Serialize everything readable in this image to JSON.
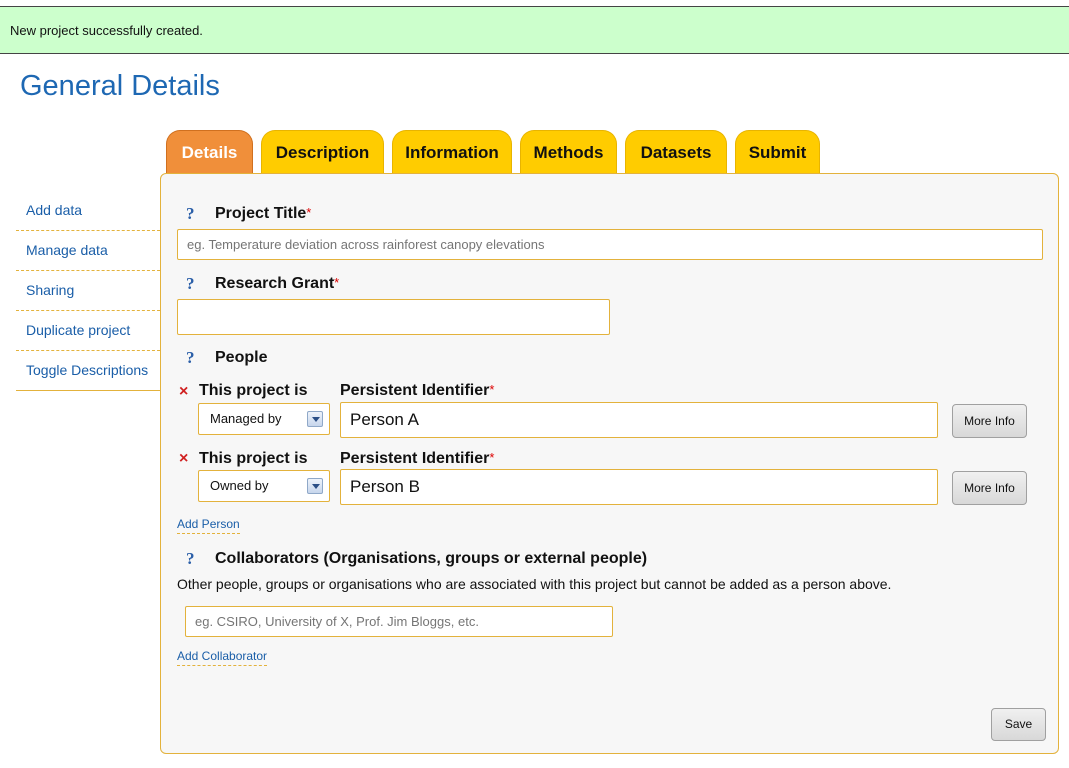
{
  "notice": {
    "message": "New project successfully created."
  },
  "page": {
    "title": "General Details"
  },
  "sidebar": {
    "items": [
      {
        "label": "Add data"
      },
      {
        "label": "Manage data"
      },
      {
        "label": "Sharing"
      },
      {
        "label": "Duplicate project"
      },
      {
        "label": "Toggle Descriptions"
      }
    ]
  },
  "tabs": [
    {
      "label": "Details",
      "active": true
    },
    {
      "label": "Description"
    },
    {
      "label": "Information"
    },
    {
      "label": "Methods"
    },
    {
      "label": "Datasets"
    },
    {
      "label": "Submit"
    }
  ],
  "form": {
    "help_glyph": "?",
    "required_mark": "*",
    "project_title": {
      "label": "Project Title",
      "value": "",
      "placeholder": "eg. Temperature deviation across rainforest canopy elevations"
    },
    "research_grant": {
      "label": "Research Grant",
      "value": "",
      "placeholder": ""
    },
    "people": {
      "label": "People",
      "relation_label": "This project is",
      "identifier_label": "Persistent Identifier",
      "remove_glyph": "×",
      "more_info_label": "More Info",
      "entries": [
        {
          "relation": "Managed by",
          "identifier": "Person A"
        },
        {
          "relation": "Owned by",
          "identifier": "Person B"
        }
      ],
      "add_label": "Add Person"
    },
    "collaborators": {
      "label": "Collaborators (Organisations, groups or external people)",
      "description": "Other people, groups or organisations who are associated with this project but cannot be added as a person above.",
      "value": "",
      "placeholder": "eg. CSIRO, University of X, Prof. Jim Bloggs, etc.",
      "add_label": "Add Collaborator"
    },
    "save_label": "Save"
  },
  "colors": {
    "notice_bg": "#ccffcc",
    "title_blue": "#1e68b3",
    "tab_yellow": "#ffcc00",
    "tab_active": "#f08f3a",
    "border_gold": "#e3b23c"
  }
}
